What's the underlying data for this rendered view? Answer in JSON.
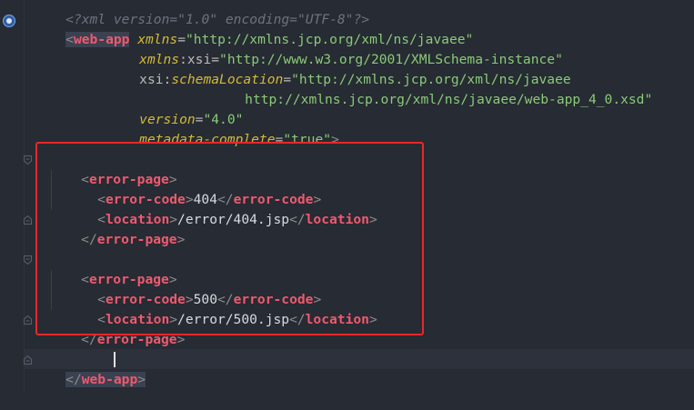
{
  "editor": {
    "line_0": {
      "text": "<?xml version=\"1.0\" encoding=\"UTF-8\"?>"
    },
    "root_tag": "web-app",
    "ns_attrs": [
      {
        "name": "xmlns",
        "value": "\"http://xmlns.jcp.org/xml/ns/javaee\""
      },
      {
        "prefix": "xmlns",
        "local": "xsi",
        "value": "\"http://www.w3.org/2001/XMLSchema-instance\""
      },
      {
        "prefix": "xsi",
        "local": "schemaLocation",
        "value": "\"http://xmlns.jcp.org/xml/ns/javaee"
      },
      {
        "continuation": "http://xmlns.jcp.org/xml/ns/javaee/web-app_4_0.xsd\""
      },
      {
        "name": "version",
        "value": "\"4.0\""
      },
      {
        "name": "metadata-complete",
        "value": "\"true\""
      }
    ],
    "error_pages": [
      {
        "tag": "error-page",
        "code_tag": "error-code",
        "code": "404",
        "location_tag": "location",
        "location": "/error/404.jsp"
      },
      {
        "tag": "error-page",
        "code_tag": "error-code",
        "code": "500",
        "location_tag": "location",
        "location": "/error/500.jsp"
      }
    ],
    "closing_root": "web-app"
  }
}
